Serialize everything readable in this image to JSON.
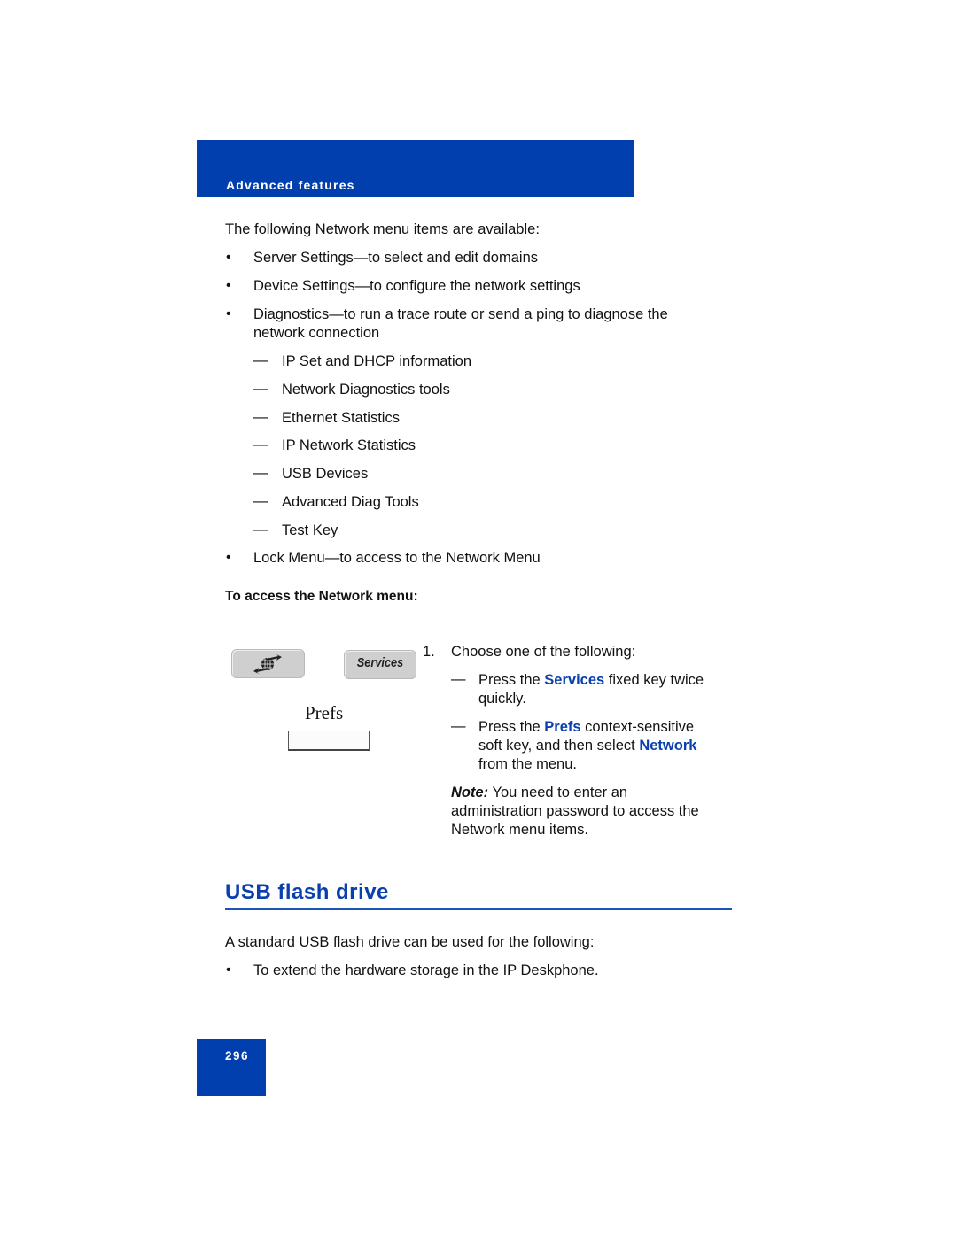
{
  "header": {
    "section_title": "Advanced features"
  },
  "intro": "The following Network menu items are available:",
  "menu_items": [
    {
      "text": "Server Settings—to select and edit domains"
    },
    {
      "text": "Device Settings—to configure the network settings"
    },
    {
      "text_line1": "Diagnostics—to run a trace route or send a ping to diagnose the",
      "text_line2": "network connection"
    },
    {
      "text": "Lock Menu—to access to the Network Menu"
    }
  ],
  "diagnostics_subitems": [
    "IP Set and DHCP information",
    "Network Diagnostics tools",
    "Ethernet Statistics",
    "IP Network Statistics",
    "USB Devices",
    "Advanced Diag Tools",
    "Test Key"
  ],
  "bullet_glyph": "•",
  "dash_glyph": "—",
  "procedure": {
    "heading": "To access the Network menu:",
    "step_number": "1.",
    "step_text": "Choose one of the following:",
    "option1": {
      "prefix": "Press the ",
      "key": "Services",
      "suffix": " fixed key twice",
      "line2": "quickly."
    },
    "option2": {
      "prefix": "Press the ",
      "key": "Prefs",
      "suffix": " context-sensitive",
      "line2_prefix": "soft key, and then select ",
      "line2_key": "Network",
      "line3": "from the menu."
    },
    "note_label": "Note:",
    "note_line1": " You need to enter an",
    "note_line2": "administration password to access the",
    "note_line3": "Network menu items."
  },
  "keys": {
    "globe_key_icon": "globe-arrows-icon",
    "services_key_label": "Services",
    "prefs_label": "Prefs"
  },
  "usb_section": {
    "title": "USB flash drive",
    "intro": "A standard USB flash drive can be used for the following:",
    "items": [
      "To extend the hardware storage in the IP Deskphone."
    ]
  },
  "page_number": "296",
  "colors": {
    "brand_blue": "#003fad",
    "link_blue": "#0a3fae"
  }
}
